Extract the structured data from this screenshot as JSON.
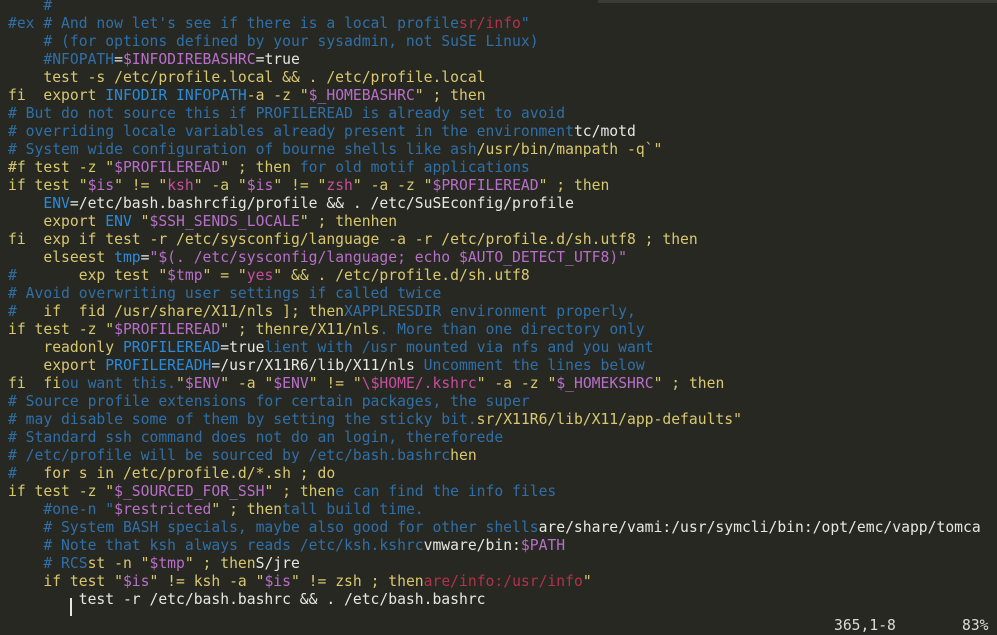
{
  "editor": {
    "lines": [
      [
        [
          "c",
          "    #"
        ]
      ],
      [
        [
          "c",
          "#ex # And now let's see if there is a local profile"
        ],
        [
          "r",
          "sr/info"
        ],
        [
          "c",
          "\""
        ]
      ],
      [
        [
          "c",
          "    # (for options defined by your sysadmin, not SuSE Linux)"
        ]
      ],
      [
        [
          "c",
          "    #NFOPATH"
        ],
        [
          "w",
          "="
        ],
        [
          "v",
          "$INFODIREBASHRC"
        ],
        [
          "w",
          "=true"
        ]
      ],
      [
        [
          "y",
          "    test -s /etc/profile.local && . /etc/profile.local"
        ]
      ],
      [
        [
          "k",
          "fi  "
        ],
        [
          "y",
          "export "
        ],
        [
          "b",
          "INFODIR INFOPATH"
        ],
        [
          "y",
          "-a -z \""
        ],
        [
          "v",
          "$_HOMEBASHRC"
        ],
        [
          "y",
          "\" ; then"
        ]
      ],
      [
        [
          "c",
          "# But do not source this if PROFILEREAD is already set to avoid"
        ]
      ],
      [
        [
          "c",
          "# overriding locale variables already present in the environment"
        ],
        [
          "w",
          "tc/motd"
        ]
      ],
      [
        [
          "c",
          "# System wide configuration of bourne shells like ash"
        ],
        [
          "y",
          "/usr/bin/manpath -q`\""
        ]
      ],
      [
        [
          "k",
          "#f test -z \""
        ],
        [
          "v",
          "$PROFILEREAD"
        ],
        [
          "k",
          "\" ; then "
        ],
        [
          "c",
          "for old motif applications"
        ]
      ],
      [
        [
          "k",
          "if test \""
        ],
        [
          "v",
          "$is"
        ],
        [
          "k",
          "\" != \""
        ],
        [
          "s",
          "ksh"
        ],
        [
          "k",
          "\" -a \""
        ],
        [
          "v",
          "$is"
        ],
        [
          "k",
          "\" != \""
        ],
        [
          "s",
          "zsh"
        ],
        [
          "k",
          "\" -a -z \""
        ],
        [
          "v",
          "$PROFILEREAD"
        ],
        [
          "k",
          "\" ; then"
        ]
      ],
      [
        [
          "b",
          "    ENV"
        ],
        [
          "w",
          "=/etc/bash.bashrcfig/profile && . /etc/SuSEconfig/profile"
        ]
      ],
      [
        [
          "y",
          "    export "
        ],
        [
          "b",
          "ENV "
        ],
        [
          "y",
          "\""
        ],
        [
          "v",
          "$SSH_SENDS_LOCALE"
        ],
        [
          "y",
          "\" ; thenhen"
        ]
      ],
      [
        [
          "k",
          "fi  "
        ],
        [
          "y",
          "exp if test -r /etc/sysconfig/language -a -r /etc/profile.d/sh.utf8 ; then"
        ]
      ],
      [
        [
          "y",
          "    elseest "
        ],
        [
          "b",
          "tmp"
        ],
        [
          "w",
          "="
        ],
        [
          "v",
          "\"$(. /etc/sysconfig/language; echo $AUTO_DETECT_UTF8)\""
        ]
      ],
      [
        [
          "c",
          "#   "
        ],
        [
          "y",
          "    exp test \""
        ],
        [
          "v",
          "$tmp"
        ],
        [
          "y",
          "\" = \""
        ],
        [
          "s",
          "yes"
        ],
        [
          "y",
          "\" && . /etc/profile.d/sh.utf8"
        ]
      ],
      [
        [
          "c",
          "# Avoid overwriting user settings if called twice"
        ]
      ],
      [
        [
          "c",
          "#   "
        ],
        [
          "y",
          "if  fid /usr/share/X11/nls ]; then"
        ],
        [
          "c",
          "XAPPLRESDIR environment properly,"
        ]
      ],
      [
        [
          "k",
          "if test -z \""
        ],
        [
          "v",
          "$PROFILEREAD"
        ],
        [
          "k",
          "\" ; then"
        ],
        [
          "y",
          "re/X11/nls"
        ],
        [
          "c",
          ". More than one directory only"
        ]
      ],
      [
        [
          "y",
          "    readonly "
        ],
        [
          "b",
          "PROFILEREAD"
        ],
        [
          "w",
          "=true"
        ],
        [
          "c",
          "lient with /usr mounted via nfs and you want"
        ]
      ],
      [
        [
          "y",
          "    export "
        ],
        [
          "b",
          "PROFILEREADH"
        ],
        [
          "w",
          "=/usr/X11R6/lib/X11/nls "
        ],
        [
          "c",
          "Uncomment the lines below"
        ]
      ],
      [
        [
          "k",
          "fi  "
        ],
        [
          "y",
          "fi"
        ],
        [
          "c",
          "ou want this."
        ],
        [
          "y",
          "\""
        ],
        [
          "v",
          "$ENV"
        ],
        [
          "y",
          "\" -a \""
        ],
        [
          "v",
          "$ENV"
        ],
        [
          "y",
          "\" != \""
        ],
        [
          "s",
          "\\$HOME/.kshrc"
        ],
        [
          "y",
          "\" -a -z \""
        ],
        [
          "v",
          "$_HOMEKSHRC"
        ],
        [
          "y",
          "\" ; then"
        ]
      ],
      [
        [
          "c",
          "# Source profile extensions for certain packages, the super"
        ]
      ],
      [
        [
          "c",
          "# may disable some of them by setting the sticky bit."
        ],
        [
          "y",
          "sr/X11R6/lib/X11/app-defaults\""
        ]
      ],
      [
        [
          "c",
          "# Standard ssh command does not do an login, thereforede"
        ]
      ],
      [
        [
          "c",
          "# /etc/profile will be sourced by /etc/bash.bashrc"
        ],
        [
          "y",
          "hen"
        ]
      ],
      [
        [
          "c",
          "#   "
        ],
        [
          "y",
          "for s in /etc/profile.d/*.sh ; do"
        ]
      ],
      [
        [
          "k",
          "if test -z \""
        ],
        [
          "v",
          "$_SOURCED_FOR_SSH"
        ],
        [
          "k",
          "\" ; then"
        ],
        [
          "c",
          "e can find the info files"
        ]
      ],
      [
        [
          "c",
          "    #one-n \""
        ],
        [
          "v",
          "$restricted"
        ],
        [
          "y",
          "\" ; then"
        ],
        [
          "c",
          "tall build time."
        ]
      ],
      [
        [
          "c",
          "    # System BASH specials, maybe also good for other shells"
        ],
        [
          "w",
          "are/share/vami:/usr/symcli/bin:/opt/emc/vapp/tomca"
        ]
      ],
      [
        [
          "c",
          "    # Note that ksh always reads /etc/ksh.kshrc"
        ],
        [
          "w",
          "vmware/bin:"
        ],
        [
          "v",
          "$PATH"
        ]
      ],
      [
        [
          "c",
          "    # RCS"
        ],
        [
          "y",
          "st -n \""
        ],
        [
          "v",
          "$tmp"
        ],
        [
          "y",
          "\" ; then"
        ],
        [
          "w",
          "S/jre"
        ]
      ],
      [
        [
          "y",
          "    if test \""
        ],
        [
          "v",
          "$is"
        ],
        [
          "y",
          "\" != ksh -a \""
        ],
        [
          "v",
          "$is"
        ],
        [
          "y",
          "\" != zsh ; then"
        ],
        [
          "r",
          "are/info:/usr/info"
        ],
        [
          "y",
          "\""
        ]
      ],
      [
        [
          "w",
          "        test -r /etc/bash.bashrc && . /etc/bash.bashrc"
        ]
      ]
    ]
  },
  "statusbar": {
    "position": "365,1-8",
    "percent": "83%"
  }
}
